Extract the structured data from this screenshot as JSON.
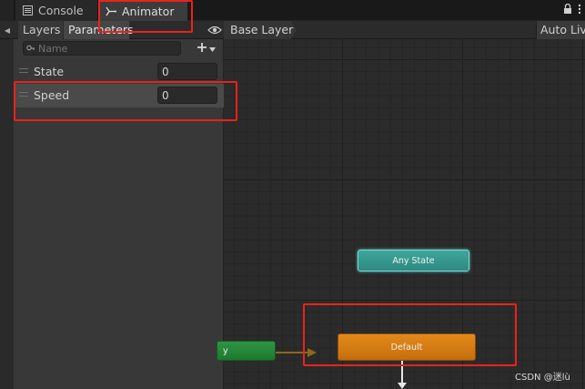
{
  "tabs": {
    "console_label": "Console",
    "animator_label": "Animator"
  },
  "toolbar": {
    "layers_label": "Layers",
    "parameters_label": "Parameters",
    "breadcrumb": "Base Layer",
    "auto_live_label": "Auto Live"
  },
  "parameters": {
    "search_placeholder": "Name",
    "items": [
      {
        "name": "State",
        "value": "0"
      },
      {
        "name": "Speed",
        "value": "0"
      }
    ]
  },
  "graph": {
    "any_state_label": "Any State",
    "entry_label": "y",
    "default_label": "Default"
  },
  "watermark": "CSDN @迷lù",
  "colors": {
    "highlight": "#e8231b",
    "any_state": "#3fa69c",
    "entry": "#2f9443",
    "default_state": "#e38a1b",
    "transition_arrow": "#8a6a1a"
  }
}
